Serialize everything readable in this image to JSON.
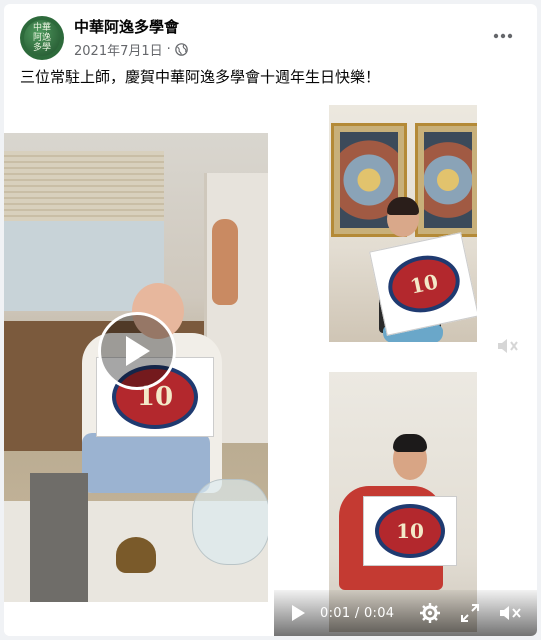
{
  "post": {
    "page_name": "中華阿逸多學會",
    "date": "2021年7月1日",
    "separator": "·",
    "text": "三位常駐上師，慶賀中華阿逸多學會十週年生日快樂！",
    "avatar_label": "中華阿逸多學會",
    "more_icon": "more-horizontal-icon",
    "audience_icon": "globe-icon"
  },
  "media": {
    "sign_number": "10",
    "player": {
      "current_time": "0:01",
      "separator": "/",
      "duration": "0:04",
      "icons": [
        "play-icon",
        "gear-icon",
        "expand-icon",
        "volume-mute-icon"
      ]
    }
  }
}
